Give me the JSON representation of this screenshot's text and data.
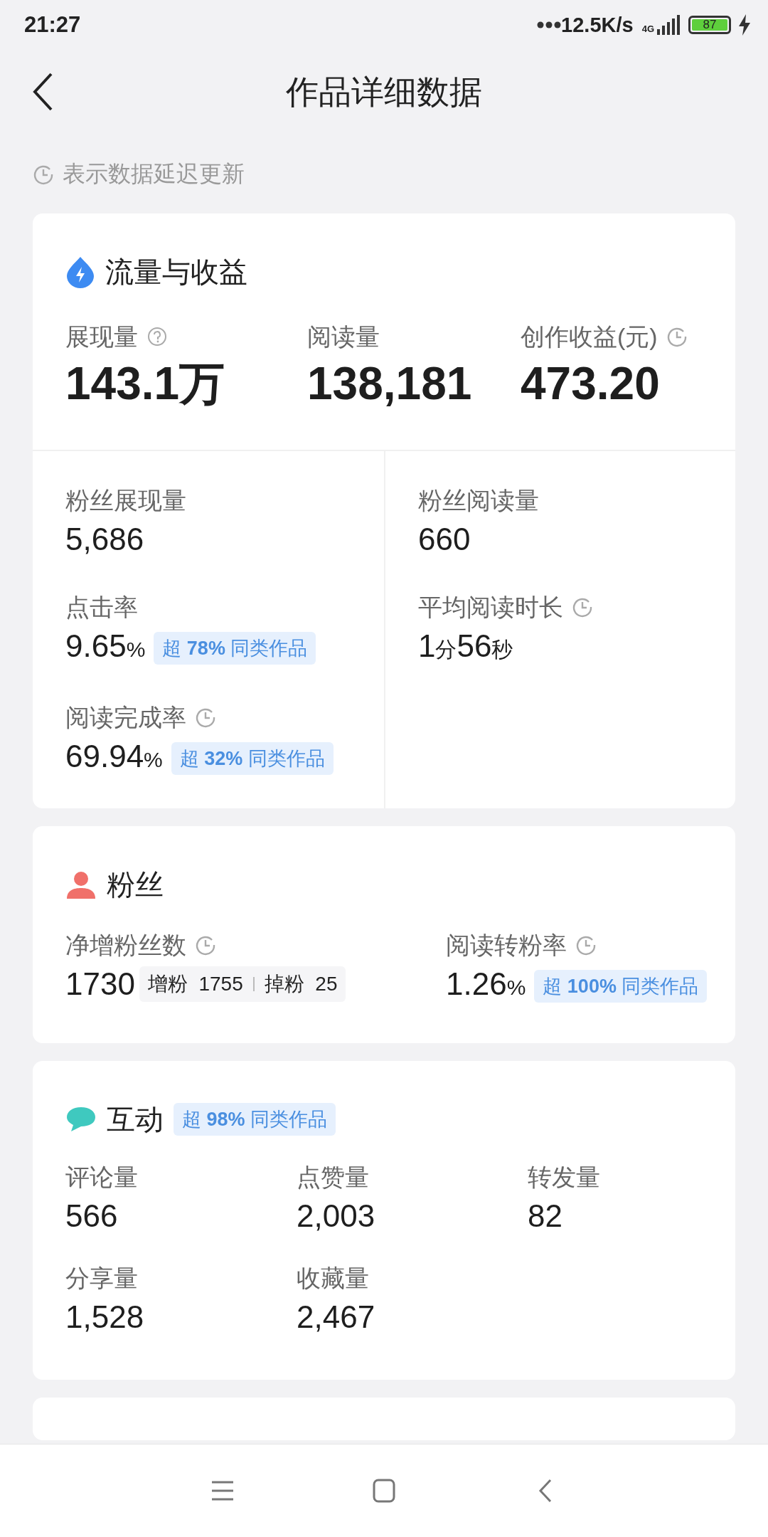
{
  "status_bar": {
    "time": "21:27",
    "network_speed": "12.5K/s",
    "network_type": "4G",
    "battery": "87"
  },
  "header": {
    "title": "作品详细数据"
  },
  "note": {
    "text": "表示数据延迟更新"
  },
  "sections": [
    {
      "kind": "traffic",
      "title": "流量与收益",
      "top_metrics": [
        {
          "label": "展现量",
          "help": true,
          "delayed": false,
          "value": "143.1万"
        },
        {
          "label": "阅读量",
          "help": false,
          "delayed": false,
          "value": "138,181"
        },
        {
          "label": "创作收益(元)",
          "help": false,
          "delayed": true,
          "value": "473.20"
        }
      ],
      "columns": [
        [
          {
            "label": "粉丝展现量",
            "delayed": false,
            "value": "5,686"
          },
          {
            "label": "点击率",
            "delayed": false,
            "value": "9.65%",
            "badge": "超 **78%** 同类作品"
          },
          {
            "label": "阅读完成率",
            "delayed": true,
            "value": "69.94%",
            "badge": "超 **32%** 同类作品"
          }
        ],
        [
          {
            "label": "粉丝阅读量",
            "delayed": false,
            "value": "660"
          },
          {
            "label": "平均阅读时长",
            "delayed": true,
            "value": "1分56秒"
          }
        ]
      ]
    },
    {
      "kind": "fans",
      "title": "粉丝",
      "metrics": [
        {
          "label": "净增粉丝数",
          "delayed": true,
          "value": "1730",
          "breakdown": [
            {
              "label": "增粉",
              "value": "1755"
            },
            {
              "label": "掉粉",
              "value": "25"
            }
          ]
        },
        {
          "label": "阅读转粉率",
          "delayed": true,
          "value": "1.26%",
          "badge": "超 **100%** 同类作品"
        }
      ]
    },
    {
      "kind": "interaction",
      "title": "互动",
      "badge": "超 **98%** 同类作品",
      "metrics": [
        {
          "label": "评论量",
          "value": "566"
        },
        {
          "label": "点赞量",
          "value": "2,003"
        },
        {
          "label": "转发量",
          "value": "82"
        },
        {
          "label": "分享量",
          "value": "1,528"
        },
        {
          "label": "收藏量",
          "value": "2,467"
        }
      ]
    }
  ]
}
